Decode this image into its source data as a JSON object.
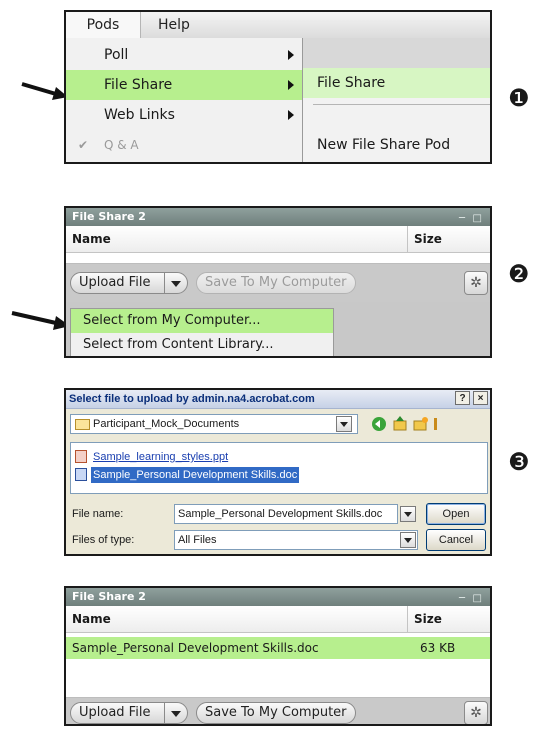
{
  "step_markers": [
    "❶",
    "❷",
    "❸"
  ],
  "panel1": {
    "menubar": [
      "Pods",
      "Help"
    ],
    "menu_items": [
      {
        "label": "Poll",
        "submenu": true
      },
      {
        "label": "File Share",
        "submenu": true,
        "highlighted": true
      },
      {
        "label": "Web Links",
        "submenu": true
      },
      {
        "label": "Q & A",
        "checked": true,
        "disabled": true
      }
    ],
    "submenu_items": [
      "File Share",
      "New File Share Pod"
    ]
  },
  "panel2": {
    "pod_title": "File Share 2",
    "columns": [
      "Name",
      "Size"
    ],
    "upload_button": "Upload File",
    "save_button": "Save To My Computer",
    "upload_menu": [
      "Select from My Computer...",
      "Select from Content Library..."
    ]
  },
  "panel3": {
    "title": "Select file to upload by admin.na4.acrobat.com",
    "help_btn": "?",
    "close_btn": "×",
    "look_in": "Participant_Mock_Documents",
    "files": [
      "Sample_learning_styles.ppt",
      "Sample_Personal Development Skills.doc"
    ],
    "file_name_label": "File name:",
    "file_name_value": "Sample_Personal Development Skills.doc",
    "file_type_label": "Files of type:",
    "file_type_value": "All Files",
    "open_button": "Open",
    "cancel_button": "Cancel"
  },
  "panel4": {
    "pod_title": "File Share 2",
    "columns": [
      "Name",
      "Size"
    ],
    "rows": [
      {
        "name": "Sample_Personal Development Skills.doc",
        "size": "63 KB"
      }
    ],
    "upload_button": "Upload File",
    "save_button": "Save To My Computer"
  },
  "colors": {
    "highlight": "#b7ef8e",
    "pod_title": "#7d8d8a",
    "selection": "#316ac5"
  }
}
